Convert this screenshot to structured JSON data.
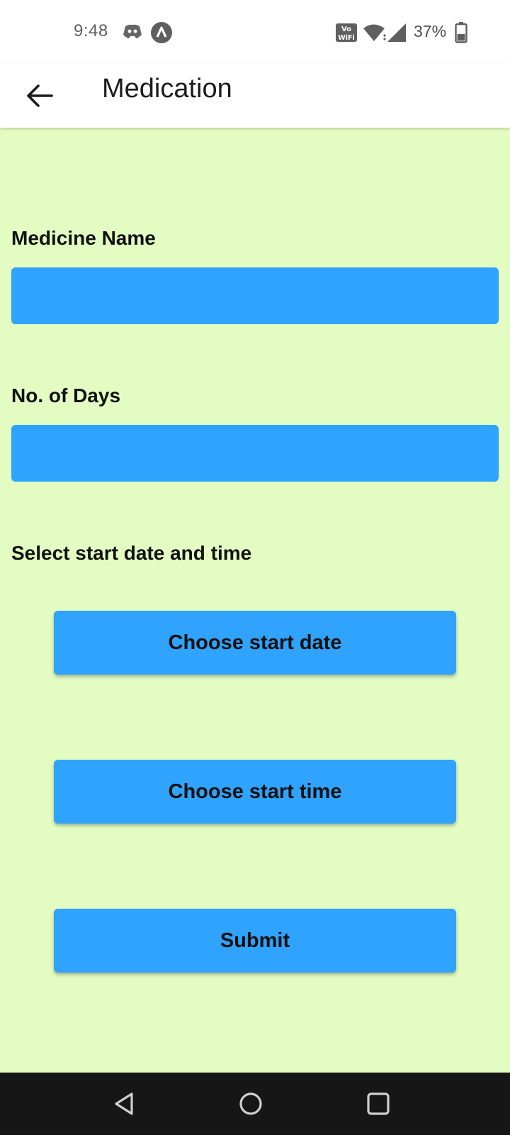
{
  "status_bar": {
    "time": "9:48",
    "battery": "37%",
    "icons": [
      "discord-icon",
      "app-a-icon",
      "vowifi-icon",
      "wifi-icon",
      "signal-icon",
      "battery-icon"
    ]
  },
  "app_bar": {
    "title": "Medication",
    "back_icon": "arrow-left-icon"
  },
  "form": {
    "medicine_name_label": "Medicine Name",
    "medicine_name_value": "",
    "days_label": "No. of Days",
    "days_value": "",
    "schedule_label": "Select start date and time",
    "start_date_button": "Choose start date",
    "start_time_button": "Choose start time",
    "submit_button": "Submit"
  },
  "nav_bar": {
    "icons": [
      "back-triangle-icon",
      "home-circle-icon",
      "recents-square-icon"
    ]
  },
  "colors": {
    "background": "#e3fcc2",
    "accent": "#2fa3fd",
    "nav_bar": "#161616"
  }
}
